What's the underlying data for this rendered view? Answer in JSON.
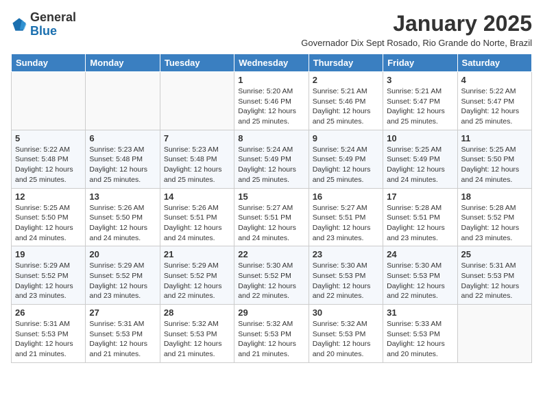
{
  "logo": {
    "general": "General",
    "blue": "Blue"
  },
  "title": "January 2025",
  "subtitle": "Governador Dix Sept Rosado, Rio Grande do Norte, Brazil",
  "days_of_week": [
    "Sunday",
    "Monday",
    "Tuesday",
    "Wednesday",
    "Thursday",
    "Friday",
    "Saturday"
  ],
  "weeks": [
    [
      {
        "day": "",
        "info": ""
      },
      {
        "day": "",
        "info": ""
      },
      {
        "day": "",
        "info": ""
      },
      {
        "day": "1",
        "info": "Sunrise: 5:20 AM\nSunset: 5:46 PM\nDaylight: 12 hours and 25 minutes."
      },
      {
        "day": "2",
        "info": "Sunrise: 5:21 AM\nSunset: 5:46 PM\nDaylight: 12 hours and 25 minutes."
      },
      {
        "day": "3",
        "info": "Sunrise: 5:21 AM\nSunset: 5:47 PM\nDaylight: 12 hours and 25 minutes."
      },
      {
        "day": "4",
        "info": "Sunrise: 5:22 AM\nSunset: 5:47 PM\nDaylight: 12 hours and 25 minutes."
      }
    ],
    [
      {
        "day": "5",
        "info": "Sunrise: 5:22 AM\nSunset: 5:48 PM\nDaylight: 12 hours and 25 minutes."
      },
      {
        "day": "6",
        "info": "Sunrise: 5:23 AM\nSunset: 5:48 PM\nDaylight: 12 hours and 25 minutes."
      },
      {
        "day": "7",
        "info": "Sunrise: 5:23 AM\nSunset: 5:48 PM\nDaylight: 12 hours and 25 minutes."
      },
      {
        "day": "8",
        "info": "Sunrise: 5:24 AM\nSunset: 5:49 PM\nDaylight: 12 hours and 25 minutes."
      },
      {
        "day": "9",
        "info": "Sunrise: 5:24 AM\nSunset: 5:49 PM\nDaylight: 12 hours and 25 minutes."
      },
      {
        "day": "10",
        "info": "Sunrise: 5:25 AM\nSunset: 5:49 PM\nDaylight: 12 hours and 24 minutes."
      },
      {
        "day": "11",
        "info": "Sunrise: 5:25 AM\nSunset: 5:50 PM\nDaylight: 12 hours and 24 minutes."
      }
    ],
    [
      {
        "day": "12",
        "info": "Sunrise: 5:25 AM\nSunset: 5:50 PM\nDaylight: 12 hours and 24 minutes."
      },
      {
        "day": "13",
        "info": "Sunrise: 5:26 AM\nSunset: 5:50 PM\nDaylight: 12 hours and 24 minutes."
      },
      {
        "day": "14",
        "info": "Sunrise: 5:26 AM\nSunset: 5:51 PM\nDaylight: 12 hours and 24 minutes."
      },
      {
        "day": "15",
        "info": "Sunrise: 5:27 AM\nSunset: 5:51 PM\nDaylight: 12 hours and 24 minutes."
      },
      {
        "day": "16",
        "info": "Sunrise: 5:27 AM\nSunset: 5:51 PM\nDaylight: 12 hours and 23 minutes."
      },
      {
        "day": "17",
        "info": "Sunrise: 5:28 AM\nSunset: 5:51 PM\nDaylight: 12 hours and 23 minutes."
      },
      {
        "day": "18",
        "info": "Sunrise: 5:28 AM\nSunset: 5:52 PM\nDaylight: 12 hours and 23 minutes."
      }
    ],
    [
      {
        "day": "19",
        "info": "Sunrise: 5:29 AM\nSunset: 5:52 PM\nDaylight: 12 hours and 23 minutes."
      },
      {
        "day": "20",
        "info": "Sunrise: 5:29 AM\nSunset: 5:52 PM\nDaylight: 12 hours and 23 minutes."
      },
      {
        "day": "21",
        "info": "Sunrise: 5:29 AM\nSunset: 5:52 PM\nDaylight: 12 hours and 22 minutes."
      },
      {
        "day": "22",
        "info": "Sunrise: 5:30 AM\nSunset: 5:52 PM\nDaylight: 12 hours and 22 minutes."
      },
      {
        "day": "23",
        "info": "Sunrise: 5:30 AM\nSunset: 5:53 PM\nDaylight: 12 hours and 22 minutes."
      },
      {
        "day": "24",
        "info": "Sunrise: 5:30 AM\nSunset: 5:53 PM\nDaylight: 12 hours and 22 minutes."
      },
      {
        "day": "25",
        "info": "Sunrise: 5:31 AM\nSunset: 5:53 PM\nDaylight: 12 hours and 22 minutes."
      }
    ],
    [
      {
        "day": "26",
        "info": "Sunrise: 5:31 AM\nSunset: 5:53 PM\nDaylight: 12 hours and 21 minutes."
      },
      {
        "day": "27",
        "info": "Sunrise: 5:31 AM\nSunset: 5:53 PM\nDaylight: 12 hours and 21 minutes."
      },
      {
        "day": "28",
        "info": "Sunrise: 5:32 AM\nSunset: 5:53 PM\nDaylight: 12 hours and 21 minutes."
      },
      {
        "day": "29",
        "info": "Sunrise: 5:32 AM\nSunset: 5:53 PM\nDaylight: 12 hours and 21 minutes."
      },
      {
        "day": "30",
        "info": "Sunrise: 5:32 AM\nSunset: 5:53 PM\nDaylight: 12 hours and 20 minutes."
      },
      {
        "day": "31",
        "info": "Sunrise: 5:33 AM\nSunset: 5:53 PM\nDaylight: 12 hours and 20 minutes."
      },
      {
        "day": "",
        "info": ""
      }
    ]
  ],
  "accent_color": "#3a7fc1"
}
